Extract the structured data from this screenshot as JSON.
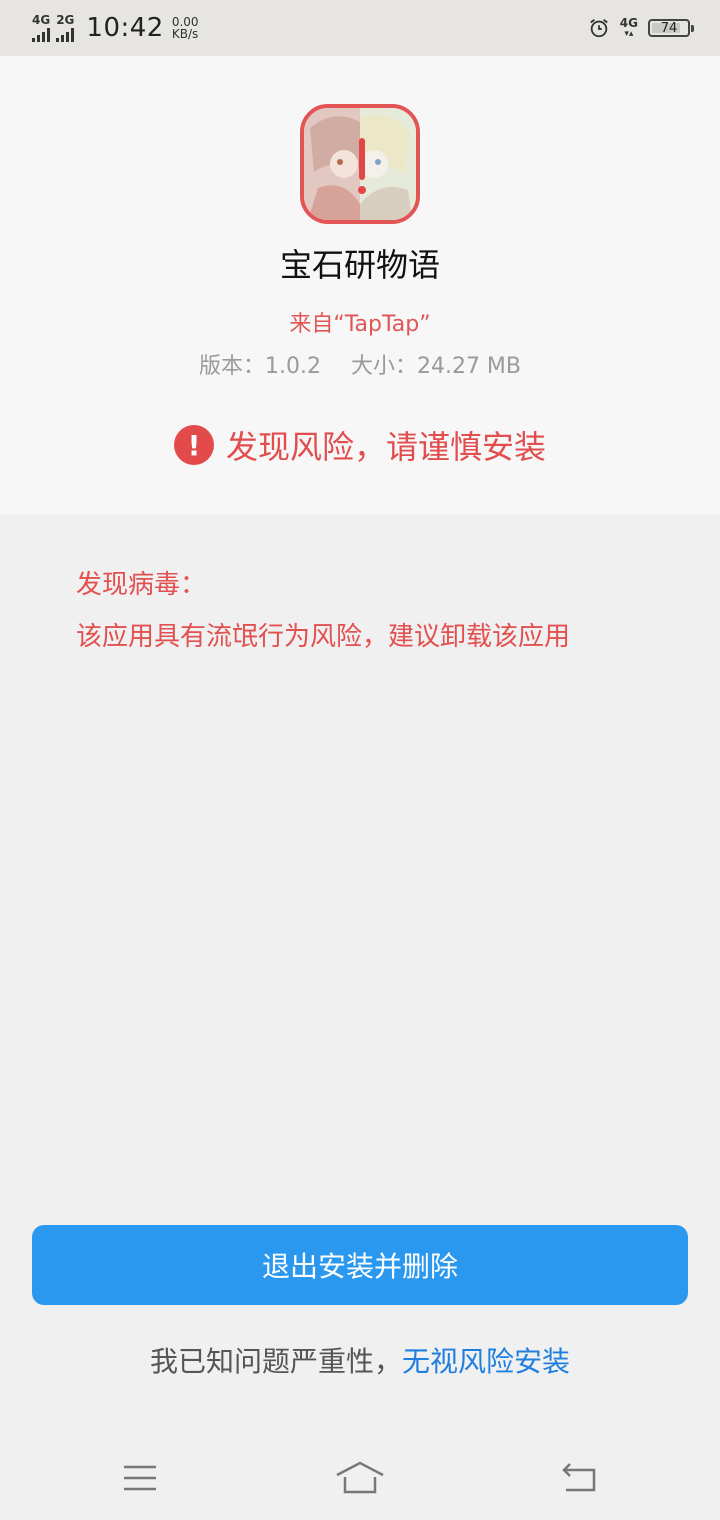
{
  "status_bar": {
    "network1": "4G",
    "network2": "2G",
    "time": "10:42",
    "speed_value": "0.00",
    "speed_unit": "KB/s",
    "network_right": "4G",
    "battery": "74",
    "battery_level_percent": 74
  },
  "app": {
    "name": "宝石研物语",
    "source": "来自“TapTap”",
    "version": "版本：1.0.2",
    "size": "大小：24.27 MB",
    "icon": "app-icon-with-warning"
  },
  "risk": {
    "icon": "exclamation-icon",
    "banner": "发现风险，请谨慎安装"
  },
  "virus": {
    "title": "发现病毒：",
    "description": "该应用具有流氓行为风险，建议卸载该应用"
  },
  "actions": {
    "primary_label": "退出安装并删除",
    "ignore_prefix": "我已知问题严重性，",
    "ignore_link": "无视风险安装"
  },
  "nav": {
    "menu_icon": "menu-icon",
    "home_icon": "home-icon",
    "back_icon": "back-icon"
  },
  "colors": {
    "status_bar_bg": "#e6e5e1",
    "panel_bg": "#f7f7f7",
    "page_bg": "#f0f0f0",
    "danger": "#e24d4d",
    "primary": "#2b98f0",
    "link": "#1e7fe0"
  }
}
